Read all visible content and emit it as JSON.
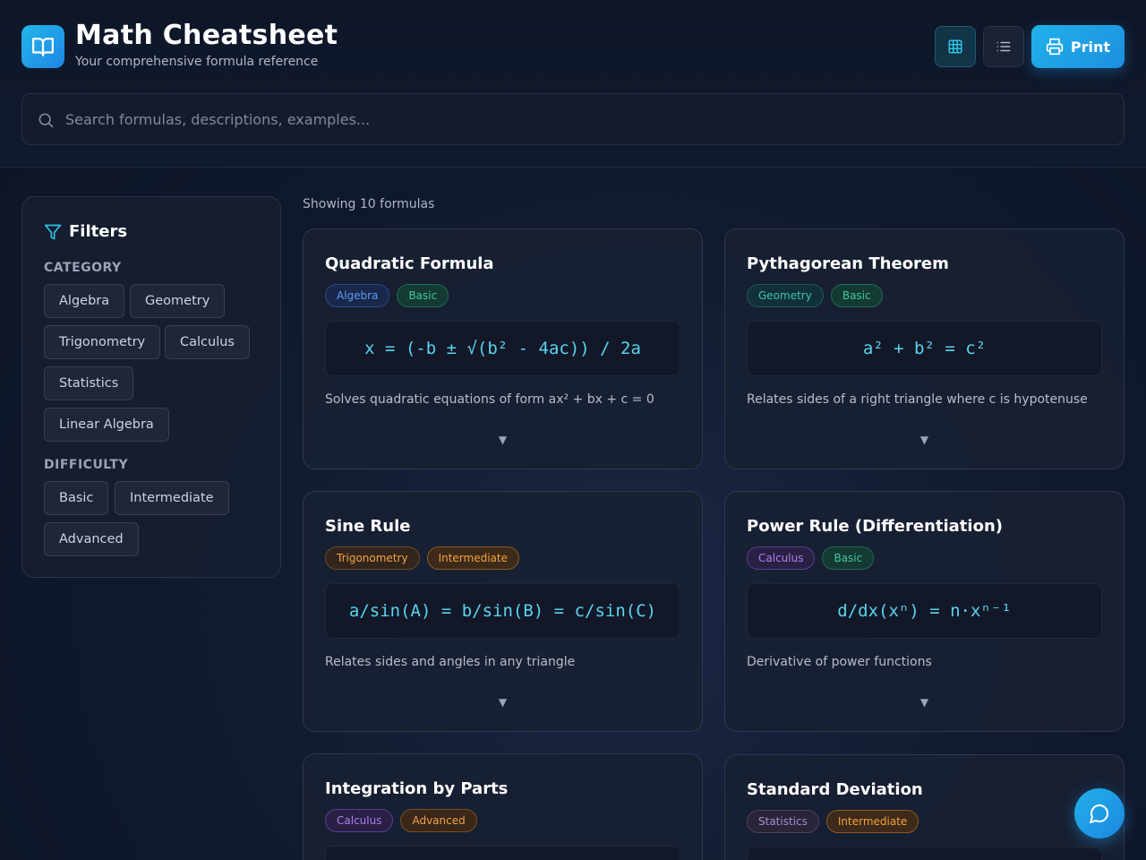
{
  "header": {
    "title": "Math Cheatsheet",
    "subtitle": "Your comprehensive formula reference",
    "print_label": "Print"
  },
  "search": {
    "placeholder": "Search formulas, descriptions, examples..."
  },
  "filters": {
    "title": "Filters",
    "category_label": "CATEGORY",
    "categories": [
      "Algebra",
      "Geometry",
      "Trigonometry",
      "Calculus",
      "Statistics",
      "Linear Algebra"
    ],
    "difficulty_label": "DIFFICULTY",
    "difficulties": [
      "Basic",
      "Intermediate",
      "Advanced"
    ]
  },
  "results": {
    "showing": "Showing 10 formulas"
  },
  "cards": [
    {
      "title": "Quadratic Formula",
      "category": "Algebra",
      "difficulty": "Basic",
      "formula": "x = (-b ± √(b² - 4ac)) / 2a",
      "description": "Solves quadratic equations of form ax² + bx + c = 0",
      "expand": "▼"
    },
    {
      "title": "Pythagorean Theorem",
      "category": "Geometry",
      "difficulty": "Basic",
      "formula": "a² + b² = c²",
      "description": "Relates sides of a right triangle where c is hypotenuse",
      "expand": "▼"
    },
    {
      "title": "Sine Rule",
      "category": "Trigonometry",
      "difficulty": "Intermediate",
      "formula": "a/sin(A) = b/sin(B) = c/sin(C)",
      "description": "Relates sides and angles in any triangle",
      "expand": "▼"
    },
    {
      "title": "Power Rule (Differentiation)",
      "category": "Calculus",
      "difficulty": "Basic",
      "formula": "d/dx(xⁿ) = n·xⁿ⁻¹",
      "description": "Derivative of power functions",
      "expand": "▼"
    },
    {
      "title": "Integration by Parts",
      "category": "Calculus",
      "difficulty": "Advanced",
      "formula": "",
      "description": "",
      "expand": ""
    },
    {
      "title": "Standard Deviation",
      "category": "Statistics",
      "difficulty": "Intermediate",
      "formula": "",
      "description": "",
      "expand": ""
    }
  ],
  "colors": {
    "accent": "#22b1ea",
    "formula_text": "#5ad4ee",
    "background": "#111a2e"
  }
}
